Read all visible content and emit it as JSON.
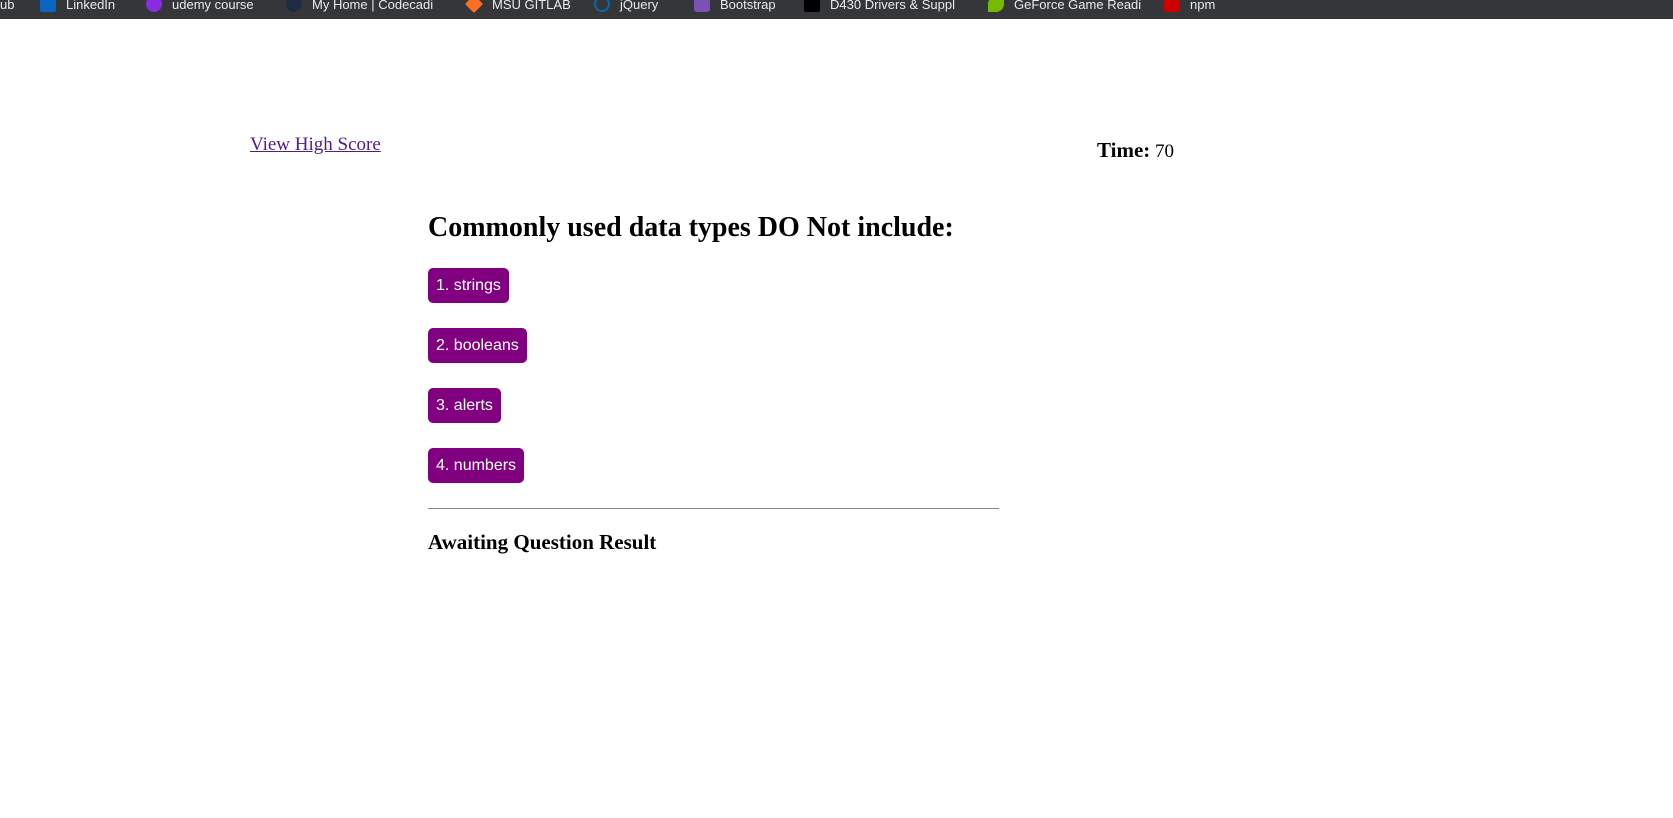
{
  "bookmarks": [
    {
      "label": "ub",
      "icon": "none"
    },
    {
      "label": "LinkedIn",
      "icon": "linkedin-icon"
    },
    {
      "label": "udemy course",
      "icon": "udemy-icon"
    },
    {
      "label": "My Home | Codecadi",
      "icon": "codecademy-icon"
    },
    {
      "label": "MSU GITLAB",
      "icon": "gitlab-icon"
    },
    {
      "label": "jQuery",
      "icon": "jquery-icon"
    },
    {
      "label": "Bootstrap",
      "icon": "bootstrap-icon"
    },
    {
      "label": "D430 Drivers & Suppl",
      "icon": "drivers-icon"
    },
    {
      "label": "GeForce Game Readi",
      "icon": "geforce-icon"
    },
    {
      "label": "npm",
      "icon": "npm-icon"
    }
  ],
  "header": {
    "high_score_link": "View High Score",
    "timer_label": "Time:",
    "timer_value": "70"
  },
  "quiz": {
    "question": "Commonly used data types DO Not include:",
    "answers": [
      {
        "label": "1. strings"
      },
      {
        "label": "2. booleans"
      },
      {
        "label": "3. alerts"
      },
      {
        "label": "4. numbers"
      }
    ],
    "result": "Awaiting Question Result"
  },
  "colors": {
    "button_bg": "#800080",
    "button_text": "#ffffff",
    "link": "#551a8b",
    "bookmarks_bar": "#35363a"
  }
}
